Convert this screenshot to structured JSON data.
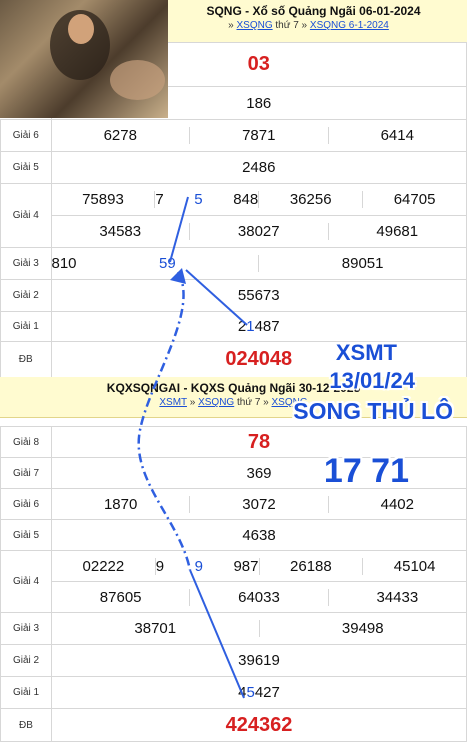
{
  "top": {
    "title": "SQNG - Xổ số Quảng Ngãi 06-01-2024",
    "crumbs": [
      {
        "text": "XSQNG",
        "link": true
      },
      {
        "text": "thứ 7",
        "link": false
      },
      {
        "text": "XSQNG 6-1-2024",
        "link": true
      }
    ],
    "giai8": "03",
    "giai7": "186",
    "giai6_label": "Giải 6",
    "giai6": [
      "6278",
      "7871",
      "6414"
    ],
    "giai5_label": "Giải 5",
    "giai5": "2486",
    "giai4_label": "Giải 4",
    "giai4_row1": [
      "75893",
      "75848",
      "36256",
      "64705"
    ],
    "giai4_row2": [
      "34583",
      "38027",
      "49681"
    ],
    "giai3_label": "Giải 3",
    "giai3": [
      "81059",
      "89051"
    ],
    "giai2_label": "Giải 2",
    "giai2": "55673",
    "giai1_label": "Giải 1",
    "giai1": "21487",
    "db_label": "ĐB",
    "db": "024048"
  },
  "bottom": {
    "title": "KQXSQNGAI - KQXS Quảng Ngãi 30-12-2023",
    "crumbs": [
      {
        "text": "XSMT",
        "link": true
      },
      {
        "text": "XSQNG",
        "link": true
      },
      {
        "text": "thứ 7",
        "link": false
      },
      {
        "text": "XSQNG",
        "link": true
      }
    ],
    "giai8_label": "Giải 8",
    "giai8": "78",
    "giai7_label": "Giải 7",
    "giai7": "369",
    "giai6_label": "Giải 6",
    "giai6": [
      "1870",
      "3072",
      "4402"
    ],
    "giai5_label": "Giải 5",
    "giai5": "4638",
    "giai4_label": "Giải 4",
    "giai4_row1": [
      "02222",
      "99987",
      "26188",
      "45104"
    ],
    "giai4_row2": [
      "87605",
      "64033",
      "34433"
    ],
    "giai3_label": "Giải 3",
    "giai3": [
      "38701",
      "39498"
    ],
    "giai2_label": "Giải 2",
    "giai2": "39619",
    "giai1_label": "Giải 1",
    "giai1": "45427",
    "db_label": "ĐB",
    "db": "424362"
  },
  "overlay": {
    "line1": "XSMT",
    "line2": "13/01/24",
    "line3": "SONG THỦ LÔ",
    "pair": "17 71"
  },
  "colors": {
    "accent": "#1a4fd6",
    "special": "#d72020",
    "header_bg": "#fffbd0"
  }
}
